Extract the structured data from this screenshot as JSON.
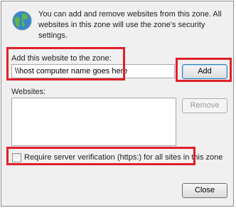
{
  "info": {
    "text": "You can add and remove websites from this zone. All websites in this zone will use the zone's security settings."
  },
  "add_section": {
    "label": "Add this website to the zone:",
    "value": "\\\\host computer name goes here",
    "add_button": "Add"
  },
  "websites": {
    "label": "Websites:",
    "items": [],
    "remove_button": "Remove"
  },
  "verification": {
    "label": "Require server verification (https:) for all sites in this zone",
    "checked": false
  },
  "footer": {
    "close_button": "Close"
  },
  "colors": {
    "highlight": "#e0202b",
    "dialog_bg": "#f0f0f0"
  }
}
